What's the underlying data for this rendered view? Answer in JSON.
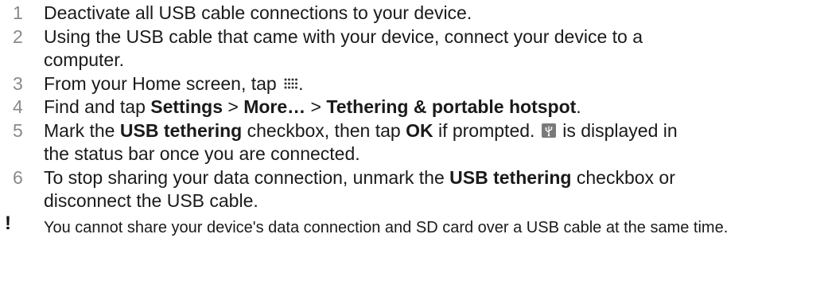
{
  "steps": [
    {
      "num": "1",
      "parts": {
        "t1": "Deactivate all USB cable connections to your device."
      }
    },
    {
      "num": "2",
      "parts": {
        "t1": "Using the USB cable that came with your device, connect your device to a",
        "t2": "computer."
      }
    },
    {
      "num": "3",
      "parts": {
        "t1": "From your Home screen, tap ",
        "t2": "."
      }
    },
    {
      "num": "4",
      "parts": {
        "t1": "Find and tap ",
        "b1": "Settings",
        "t2": " > ",
        "b2": "More…",
        "t3": " > ",
        "b3": "Tethering & portable hotspot",
        "t4": "."
      }
    },
    {
      "num": "5",
      "parts": {
        "t1": "Mark the ",
        "b1": "USB tethering",
        "t2": " checkbox, then tap ",
        "b2": "OK",
        "t3": " if prompted. ",
        "t4": " is displayed in",
        "t5": "the status bar once you are connected."
      }
    },
    {
      "num": "6",
      "parts": {
        "t1": "To stop sharing your data connection, unmark the ",
        "b1": "USB tethering",
        "t2": " checkbox or",
        "t3": "disconnect the USB cable."
      }
    }
  ],
  "icons": {
    "apps": "apps-grid-icon",
    "usb_tethering": "usb-tethering-status-icon"
  },
  "note": {
    "mark": "!",
    "text": "You cannot share your device's data connection and SD card over a USB cable at the same time."
  },
  "colors": {
    "step_number": "#8a8a8a",
    "text": "#1a1a1a",
    "usb_icon_bg": "#7a7a7a"
  }
}
